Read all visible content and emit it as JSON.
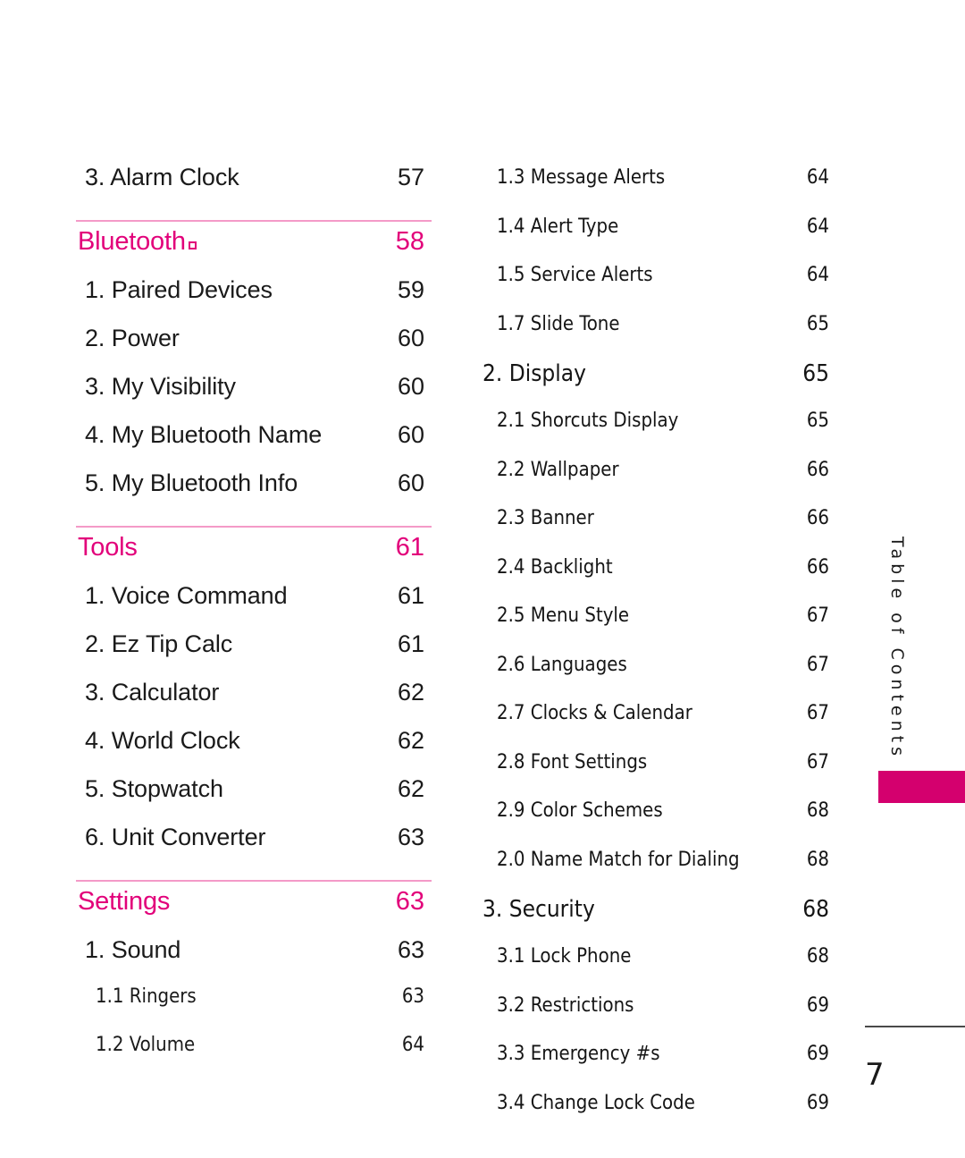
{
  "document": {
    "page_number": "7",
    "sidebar_tab_label": "Table of Contents",
    "accent_color": "#e2007a",
    "divider_color": "#f49ac8",
    "tab_block_color": "#d4006e"
  },
  "left_column": [
    {
      "level": 2,
      "label": "3. Alarm Clock",
      "page": "57",
      "divider_before": false
    },
    {
      "level": 1,
      "label": "Bluetooth",
      "trademark": true,
      "page": "58",
      "divider_before": true
    },
    {
      "level": 2,
      "label": "1. Paired Devices",
      "page": "59",
      "divider_before": false
    },
    {
      "level": 2,
      "label": "2. Power",
      "page": "60",
      "divider_before": false
    },
    {
      "level": 2,
      "label": "3. My Visibility",
      "page": "60",
      "divider_before": false
    },
    {
      "level": 2,
      "label": "4. My Bluetooth Name",
      "page": "60",
      "divider_before": false
    },
    {
      "level": 2,
      "label": "5. My Bluetooth Info",
      "page": "60",
      "divider_before": false
    },
    {
      "level": 1,
      "label": "Tools",
      "trademark": false,
      "page": "61",
      "divider_before": true
    },
    {
      "level": 2,
      "label": "1. Voice Command",
      "page": "61",
      "divider_before": false
    },
    {
      "level": 2,
      "label": "2. Ez Tip Calc",
      "page": "61",
      "divider_before": false
    },
    {
      "level": 2,
      "label": "3. Calculator",
      "page": "62",
      "divider_before": false
    },
    {
      "level": 2,
      "label": "4. World Clock",
      "page": "62",
      "divider_before": false
    },
    {
      "level": 2,
      "label": "5. Stopwatch",
      "page": "62",
      "divider_before": false
    },
    {
      "level": 2,
      "label": "6. Unit Converter",
      "page": "63",
      "divider_before": false
    },
    {
      "level": 1,
      "label": "Settings",
      "trademark": false,
      "page": "63",
      "divider_before": true
    },
    {
      "level": 2,
      "label": "1. Sound",
      "page": "63",
      "divider_before": false
    },
    {
      "level": 3,
      "label": "1.1 Ringers",
      "page": "63",
      "divider_before": false
    },
    {
      "level": 3,
      "label": "1.2 Volume",
      "page": "64",
      "divider_before": false
    }
  ],
  "right_column": [
    {
      "level": 3,
      "label": "1.3 Message Alerts",
      "page": "64"
    },
    {
      "level": 3,
      "label": "1.4 Alert Type",
      "page": "64"
    },
    {
      "level": 3,
      "label": "1.5 Service Alerts",
      "page": "64"
    },
    {
      "level": 3,
      "label": "1.7 Slide Tone",
      "page": "65"
    },
    {
      "level": 2,
      "label": "2. Display",
      "page": "65"
    },
    {
      "level": 3,
      "label": "2.1 Shorcuts Display",
      "page": "65"
    },
    {
      "level": 3,
      "label": "2.2 Wallpaper",
      "page": "66"
    },
    {
      "level": 3,
      "label": "2.3 Banner",
      "page": "66"
    },
    {
      "level": 3,
      "label": "2.4 Backlight",
      "page": "66"
    },
    {
      "level": 3,
      "label": "2.5 Menu Style",
      "page": "67"
    },
    {
      "level": 3,
      "label": "2.6 Languages",
      "page": "67"
    },
    {
      "level": 3,
      "label": "2.7 Clocks & Calendar",
      "page": "67"
    },
    {
      "level": 3,
      "label": "2.8 Font Settings",
      "page": "67"
    },
    {
      "level": 3,
      "label": "2.9 Color Schemes",
      "page": "68"
    },
    {
      "level": 3,
      "label": "2.0 Name Match for Dialing",
      "page": "68"
    },
    {
      "level": 2,
      "label": "3. Security",
      "page": "68"
    },
    {
      "level": 3,
      "label": "3.1 Lock Phone",
      "page": "68"
    },
    {
      "level": 3,
      "label": "3.2 Restrictions",
      "page": "69"
    },
    {
      "level": 3,
      "label": "3.3 Emergency #s",
      "page": "69"
    },
    {
      "level": 3,
      "label": "3.4 Change Lock Code",
      "page": "69"
    }
  ]
}
